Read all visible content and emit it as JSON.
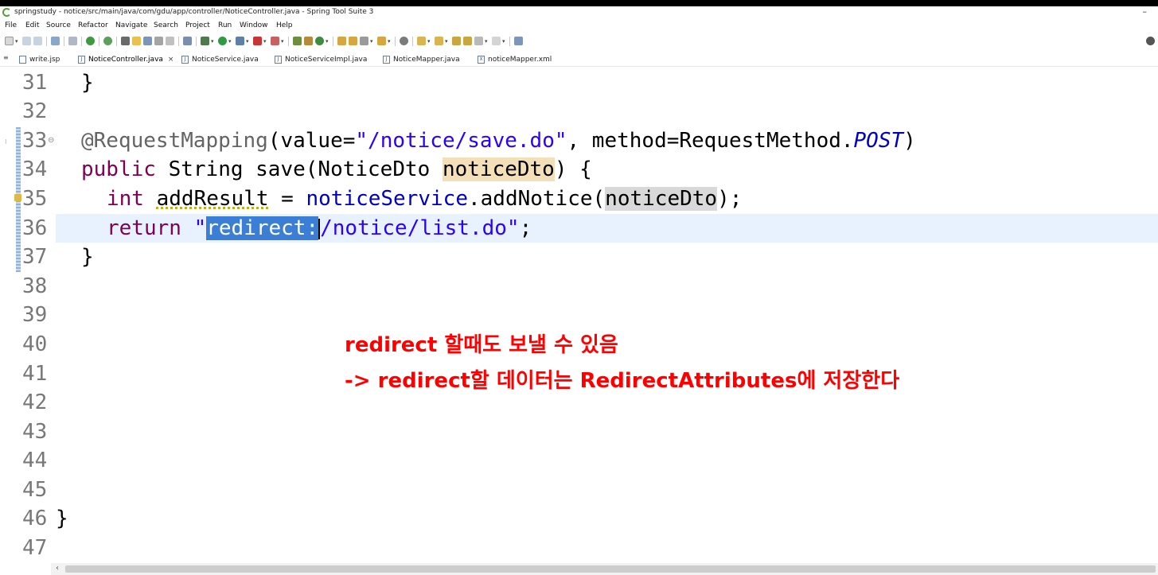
{
  "window": {
    "title": "springstudy - notice/src/main/java/com/gdu/app/controller/NoticeController.java - Spring Tool Suite 3",
    "minimize_label": "–"
  },
  "menu": [
    "File",
    "Edit",
    "Source",
    "Refactor",
    "Navigate",
    "Search",
    "Project",
    "Run",
    "Window",
    "Help"
  ],
  "tabs": [
    {
      "label": "write.jsp",
      "icon": "jsp-file-icon",
      "active": false
    },
    {
      "label": "NoticeController.java",
      "icon": "java-file-icon",
      "active": true,
      "close": "×"
    },
    {
      "label": "NoticeService.java",
      "icon": "java-file-icon",
      "active": false
    },
    {
      "label": "NoticeServiceImpl.java",
      "icon": "java-file-icon",
      "active": false
    },
    {
      "label": "NoticeMapper.java",
      "icon": "java-file-icon",
      "active": false
    },
    {
      "label": "noticeMapper.xml",
      "icon": "xml-file-icon",
      "active": false
    }
  ],
  "editor": {
    "line_numbers": [
      "31",
      "32",
      "33",
      "34",
      "35",
      "36",
      "37",
      "38",
      "39",
      "40",
      "41",
      "42",
      "43",
      "44",
      "45",
      "46",
      "47"
    ],
    "line31": "}",
    "line33": {
      "annotation": "@RequestMapping",
      "open": "(value=",
      "path": "\"/notice/save.do\"",
      "mid": ", method=RequestMethod.",
      "constant": "POST",
      "close": ")"
    },
    "line34": {
      "kw": "public",
      "sig": " String save(NoticeDto ",
      "param": "noticeDto",
      "end": ") {"
    },
    "line35": {
      "kw": "int",
      "var": "addResult",
      "assign": " = ",
      "field": "noticeService",
      "call": ".addNotice(",
      "arg": "noticeDto",
      "end": ");"
    },
    "line36": {
      "kw": "return",
      "quote": "\"",
      "selected": "redirect:",
      "rest": "/notice/list.do\"",
      "end": ";"
    },
    "line37": "}",
    "line46": "}"
  },
  "annotations": {
    "line1": "redirect 할때도 보낼 수 있음",
    "line2": "-> redirect할 데이터는 RedirectAttributes에 저장한다"
  },
  "scrollbar": {
    "left_arrow": "‹"
  }
}
